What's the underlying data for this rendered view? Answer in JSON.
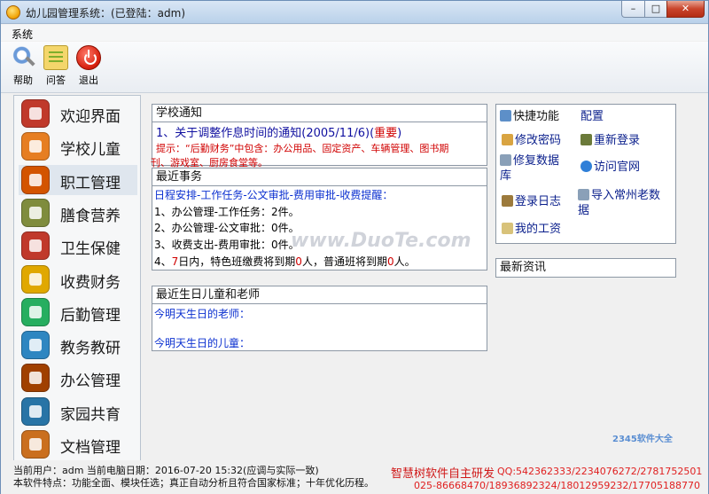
{
  "window": {
    "title": "幼儿园管理系统：(已登陆：adm)",
    "min_label": "–",
    "max_label": "□",
    "close_label": "✕"
  },
  "menu": {
    "system": "系统"
  },
  "toolbar": {
    "help": "帮助",
    "faq": "问答",
    "exit": "退出"
  },
  "sidebar": {
    "items": [
      {
        "label": "欢迎界面",
        "icon": "home-icon",
        "color": "#c0392b"
      },
      {
        "label": "学校儿童",
        "icon": "child-icon",
        "color": "#e67e22"
      },
      {
        "label": "职工管理",
        "icon": "staff-icon",
        "color": "#d35400"
      },
      {
        "label": "膳食营养",
        "icon": "food-icon",
        "color": "#7f8c3d"
      },
      {
        "label": "卫生保健",
        "icon": "health-icon",
        "color": "#c0392b"
      },
      {
        "label": "收费财务",
        "icon": "coin-icon",
        "color": "#e0a800"
      },
      {
        "label": "后勤管理",
        "icon": "box-icon",
        "color": "#27ae60"
      },
      {
        "label": "教务教研",
        "icon": "board-icon",
        "color": "#2e86c1"
      },
      {
        "label": "办公管理",
        "icon": "office-icon",
        "color": "#a04000"
      },
      {
        "label": "家园共育",
        "icon": "family-icon",
        "color": "#2874a6"
      },
      {
        "label": "文档管理",
        "icon": "document-icon",
        "color": "#ca6f1e"
      }
    ]
  },
  "notice": {
    "title": "学校通知",
    "item_prefix": "1、关于调整作息时间的通知(2005/11/6)(",
    "item_tag": "重要",
    "item_suffix": ")",
    "tip_line1": "提示：“后勤财务”中包含：办公用品、固定资产、车辆管理、图书期",
    "tip_line2": "刊、游戏室、厨房食堂等。"
  },
  "recent": {
    "title": "最近事务",
    "summary": "日程安排-工作任务-公文审批-费用审批-收费提醒：",
    "line1": "1、办公管理-工作任务：2件。",
    "line2": "2、办公管理-公文审批：0件。",
    "line3": "3、收费支出-费用审批：0件。",
    "line4_a": "4、",
    "line4_days": "7",
    "line4_b": "日内，特色班缴费将到期",
    "line4_n1": "0",
    "line4_c": "人，普通班将到期",
    "line4_n2": "0",
    "line4_d": "人。"
  },
  "birthday": {
    "title": "最近生日儿童和老师",
    "teachers": "今明天生日的老师：",
    "children": "今明天生日的儿童："
  },
  "quick": {
    "title": "快捷功能",
    "config": "配置",
    "change_password": "修改密码",
    "relogin": "重新登录",
    "repair_line1": "修复数据",
    "repair_line2": "库",
    "visit_site": "访问官网",
    "login_log": "登录日志",
    "import_line1": "导入常州老数",
    "import_line2": "据",
    "my_salary": "我的工资"
  },
  "news": {
    "title": "最新资讯"
  },
  "status": {
    "line1": "当前用户：adm  当前电脑日期：2016-07-20 15:32(应调与实际一致)",
    "line2": "本软件特点：功能全面、模块任选；真正自动分析且符合国家标准；十年优化历程。",
    "brand": "智慧树软件自主研发",
    "qq": "QQ:542362333/2234076272/2781752501",
    "phone": "025-86668470/18936892324/18012959232/17705188770"
  },
  "watermark": "www.DuoTe.com",
  "watermark_logo": "2345软件大全"
}
